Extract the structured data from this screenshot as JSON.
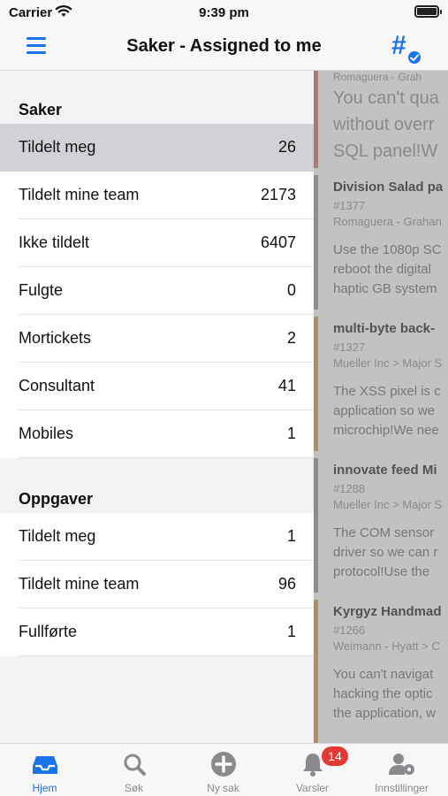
{
  "status_bar": {
    "carrier": "Carrier",
    "time": "9:39 pm"
  },
  "nav": {
    "title": "Saker - Assigned to me",
    "menu_icon": "hamburger-icon",
    "action_icon": "hash-check-icon"
  },
  "sidebar": {
    "sections": [
      {
        "title": "Saker",
        "items": [
          {
            "label": "Tildelt meg",
            "count": "26",
            "selected": true
          },
          {
            "label": "Tildelt mine team",
            "count": "2173"
          },
          {
            "label": "Ikke tildelt",
            "count": "6407"
          },
          {
            "label": "Fulgte",
            "count": "0"
          },
          {
            "label": "Mortickets",
            "count": "2"
          },
          {
            "label": "Consultant",
            "count": "41"
          },
          {
            "label": "Mobiles",
            "count": "1"
          }
        ]
      },
      {
        "title": "Oppgaver",
        "items": [
          {
            "label": "Tildelt meg",
            "count": "1"
          },
          {
            "label": "Tildelt mine team",
            "count": "96"
          },
          {
            "label": "Fullførte",
            "count": "1"
          }
        ]
      }
    ]
  },
  "background_list": {
    "top_text": "Romaguera - Grah",
    "big_text": [
      "You can't qua",
      "without overr",
      "SQL panel!W"
    ],
    "cards": [
      {
        "title": "Division Salad pa",
        "number": "#1377",
        "org": "Romaguera - Grahan",
        "body": [
          "Use the 1080p SC",
          "reboot the digital",
          "haptic GB system"
        ],
        "color": "#9e9e9e"
      },
      {
        "title": "multi-byte back-",
        "number": "#1327",
        "org": "Mueller Inc > Major S",
        "body": [
          "The XSS pixel is c",
          "application so we",
          "microchip!We nee"
        ],
        "color": "#d4a055"
      },
      {
        "title": "innovate feed Mi",
        "number": "#1288",
        "org": "Mueller Inc > Major S",
        "body": [
          "The COM sensor",
          "driver so we can r",
          "protocol!Use the"
        ],
        "color": "#9e9e9e"
      },
      {
        "title": "Kyrgyz Handmad",
        "number": "#1266",
        "org": "Weimann - Hyatt > C",
        "body": [
          "You can't navigat",
          "hacking the optic",
          "the application, w"
        ],
        "color": "#d4a055"
      }
    ],
    "accent_color": "#e57373"
  },
  "tabbar": {
    "tabs": [
      {
        "label": "Hjem",
        "icon": "inbox-icon",
        "active": true
      },
      {
        "label": "Søk",
        "icon": "search-icon"
      },
      {
        "label": "Ny sak",
        "icon": "plus-circle-icon"
      },
      {
        "label": "Varsler",
        "icon": "bell-icon"
      },
      {
        "label": "Innstillinger",
        "icon": "user-gear-icon"
      }
    ],
    "badge": "14"
  },
  "colors": {
    "accent": "#1a73e8",
    "badge": "#e53935",
    "selected_row": "#d2d2d6"
  }
}
